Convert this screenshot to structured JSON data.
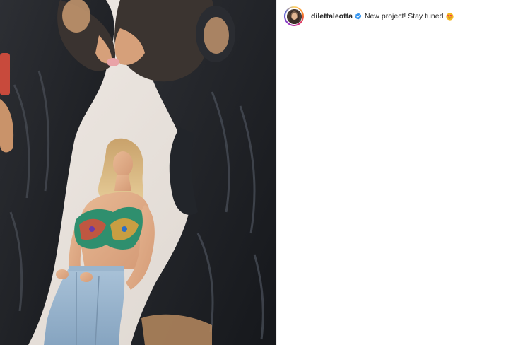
{
  "post": {
    "username": "dilettaleotta",
    "caption": "New project! Stay tuned",
    "caption_emoji": "heart-eyes-emoji",
    "verified_icon": "verified-badge-icon",
    "avatar": "profile-avatar"
  },
  "media": {
    "description_icon": "photo-mural"
  },
  "colors": {
    "verified_blue": "#3897f0",
    "text": "#262626",
    "emoji_yellow": "#f5b820",
    "emoji_heart": "#e8344e"
  }
}
